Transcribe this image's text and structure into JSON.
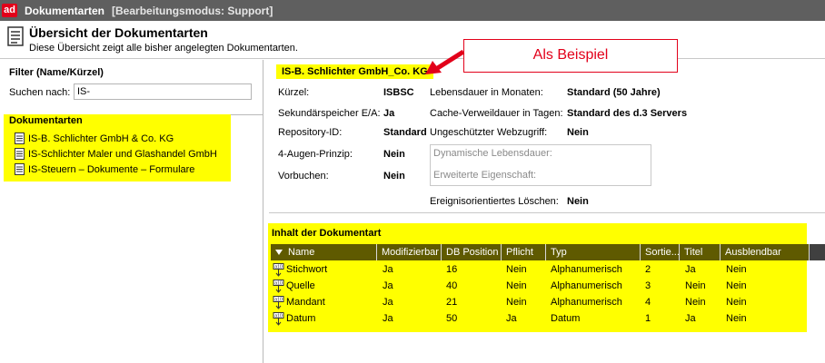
{
  "titlebar": {
    "logo": "ad",
    "title": "Dokumentarten",
    "mode": "[Bearbeitungsmodus: Support]"
  },
  "header": {
    "icon": "document-list-icon",
    "title": "Übersicht der Dokumentarten",
    "subtitle": "Diese Übersicht zeigt alle bisher angelegten Dokumentarten."
  },
  "callout": {
    "text": "Als Beispiel",
    "color": "#e2001a"
  },
  "filter": {
    "title": "Filter (Name/Kürzel)",
    "search_label": "Suchen nach:",
    "search_value": "IS-"
  },
  "tree": {
    "title": "Dokumentarten",
    "items": [
      {
        "label": "IS-B. Schlichter GmbH & Co. KG"
      },
      {
        "label": "IS-Schlichter Maler und Glashandel GmbH"
      },
      {
        "label": "IS-Steuern – Dokumente – Formulare"
      }
    ]
  },
  "details": {
    "name": "IS-B. Schlichter GmbH_Co. KG",
    "kuerzel_label": "Kürzel:",
    "kuerzel_value": "ISBSC",
    "speicher_label": "Sekundärspeicher E/A:",
    "speicher_value": "Ja",
    "repo_label": "Repository-ID:",
    "repo_value": "Standard",
    "augen_label": "4-Augen-Prinzip:",
    "augen_value": "Nein",
    "vorbuchen_label": "Vorbuchen:",
    "vorbuchen_value": "Nein",
    "lebensdauer_label": "Lebensdauer in Monaten:",
    "lebensdauer_value": "Standard (50 Jahre)",
    "cache_label": "Cache-Verweildauer in Tagen:",
    "cache_value": "Standard des d.3 Servers",
    "webzugriff_label": "Ungeschützter Webzugriff:",
    "webzugriff_value": "Nein",
    "dyn_lebensdauer": "Dynamische Lebensdauer:",
    "erw_eigenschaft": "Erweiterte Eigenschaft:",
    "loeschen_label": "Ereignisorientiertes Löschen:",
    "loeschen_value": "Nein"
  },
  "content": {
    "title": "Inhalt der Dokumentart",
    "columns": [
      "Name",
      "Modifizierbar",
      "DB Position",
      "Pflicht",
      "Typ",
      "Sortie...",
      "Titel",
      "Ausblendbar"
    ],
    "rows": [
      [
        "Stichwort",
        "Ja",
        "16",
        "Nein",
        "Alphanumerisch",
        "2",
        "Ja",
        "Nein"
      ],
      [
        "Quelle",
        "Ja",
        "40",
        "Nein",
        "Alphanumerisch",
        "3",
        "Nein",
        "Nein"
      ],
      [
        "Mandant",
        "Ja",
        "21",
        "Nein",
        "Alphanumerisch",
        "4",
        "Nein",
        "Nein"
      ],
      [
        "Datum",
        "Ja",
        "50",
        "Ja",
        "Datum",
        "1",
        "Ja",
        "Nein"
      ]
    ]
  },
  "colors": {
    "highlight": "#ffff00",
    "titlebar": "#5f5f5f",
    "grid_header": "#5f5a00"
  }
}
